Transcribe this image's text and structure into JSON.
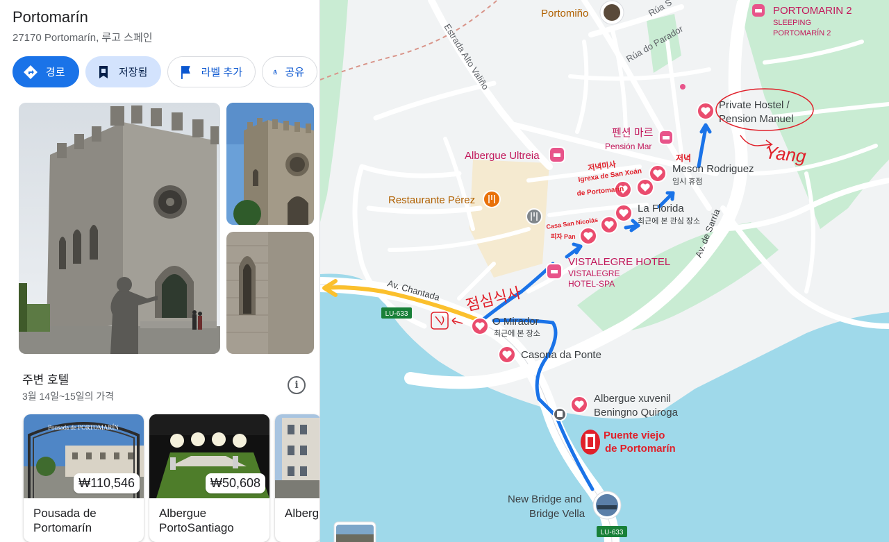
{
  "place": {
    "title": "Portomarín",
    "address": "27170 Portomarín, 루고 스페인"
  },
  "actions": [
    {
      "label": "경로",
      "icon": "directions-icon"
    },
    {
      "label": "저장됨",
      "icon": "bookmark-icon"
    },
    {
      "label": "라벨 추가",
      "icon": "flag-icon"
    },
    {
      "label": "공유",
      "icon": "share-icon"
    }
  ],
  "nearby_hotels": {
    "title": "주변 호텔",
    "dates": "3월 14일~15일의 가격",
    "hotels": [
      {
        "name": "Pousada de Portomarín",
        "price": "₩110,546",
        "sign": "Pousada de PORTOMARÍN"
      },
      {
        "name": "Albergue PortoSantiago",
        "price": "₩50,608"
      },
      {
        "name": "Albergue Pons"
      }
    ]
  },
  "map": {
    "colors": {
      "water": "#9fd9ea",
      "land": "#f1f3f4",
      "park": "#c9ecd3",
      "sand": "#f5ead0",
      "road": "#ffffff",
      "pin": "#ea4c6e",
      "route_blue": "#1a73e8",
      "route_yellow": "#fbc02d",
      "annotation_red": "#e0202a",
      "poi_magenta": "#c2185b",
      "food_orange": "#e8710a"
    },
    "streets": [
      {
        "name": "Estrada Alto Valiño"
      },
      {
        "name": "Rúa do Parador"
      },
      {
        "name": "Rúa S"
      },
      {
        "name": "Av. Chantada"
      },
      {
        "name": "Av. de Sarria"
      }
    ],
    "road_shields": [
      "LU-633",
      "LU-633"
    ],
    "places": [
      {
        "name": "Portomiño",
        "type": "lodging"
      },
      {
        "name": "PORTOMARIN 2",
        "sub1": "SLEEPING",
        "sub2": "PORTOMARÍN 2",
        "type": "lodging"
      },
      {
        "name": "Private Hostel / Pension Manuel",
        "line1": "Private Hostel /",
        "line2": "Pension Manuel",
        "type": "saved"
      },
      {
        "name": "펜션 마르",
        "sub": "Pensión Mar",
        "type": "lodging"
      },
      {
        "name": "Albergue Ultreia",
        "type": "lodging"
      },
      {
        "name": "Meson Rodriguez",
        "sub": "임시 휴점",
        "type": "saved"
      },
      {
        "name": "Restaurante Pérez",
        "type": "food"
      },
      {
        "name": "La Florida",
        "sub": "최근에 본 관심 장소",
        "type": "saved"
      },
      {
        "name": "VISTALEGRE HOTEL",
        "sub1": "VISTALEGRE",
        "sub2": "HOTEL-SPA",
        "type": "lodging"
      },
      {
        "name": "O Mirador",
        "sub": "최근에 본 장소",
        "type": "saved"
      },
      {
        "name": "Casona da Ponte",
        "type": "saved"
      },
      {
        "name": "Albergue xuvenil Beningno Quiroga",
        "line1": "Albergue xuvenil",
        "line2": "Beningno Quiroga",
        "type": "saved"
      },
      {
        "name": "New Bridge and Bridge Vella",
        "line1": "New Bridge and",
        "line2": "Bridge Vella",
        "type": "photo"
      }
    ],
    "annotations": [
      {
        "text": "Yang"
      },
      {
        "text": "저녁"
      },
      {
        "text": "저녁미사"
      },
      {
        "text": "Igrexa de San Xoán"
      },
      {
        "text": "de Portomarín"
      },
      {
        "text": "Casa San Nicolás"
      },
      {
        "text": "피자 Pan"
      },
      {
        "text": "점심식사"
      },
      {
        "text": "Puente viejo"
      },
      {
        "text": "de Portomarín"
      }
    ]
  }
}
